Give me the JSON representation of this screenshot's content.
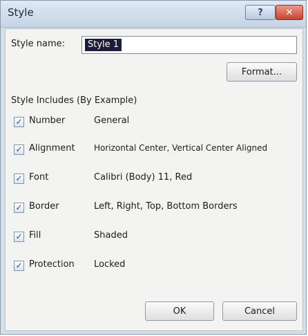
{
  "window": {
    "title": "Style",
    "help_glyph": "?",
    "close_glyph": "✕"
  },
  "style_name": {
    "label": "Style name:",
    "value": "Style 1"
  },
  "format_button": "Format...",
  "group_label": "Style Includes (By Example)",
  "includes": [
    {
      "name": "Number",
      "value": "General",
      "checked": true
    },
    {
      "name": "Alignment",
      "value": "Horizontal Center, Vertical Center Aligned",
      "checked": true
    },
    {
      "name": "Font",
      "value": "Calibri (Body) 11, Red",
      "checked": true
    },
    {
      "name": "Border",
      "value": "Left, Right, Top, Bottom Borders",
      "checked": true
    },
    {
      "name": "Fill",
      "value": "Shaded",
      "checked": true
    },
    {
      "name": "Protection",
      "value": "Locked",
      "checked": true
    }
  ],
  "checkmark_glyph": "✓",
  "ok_button": "OK",
  "cancel_button": "Cancel"
}
